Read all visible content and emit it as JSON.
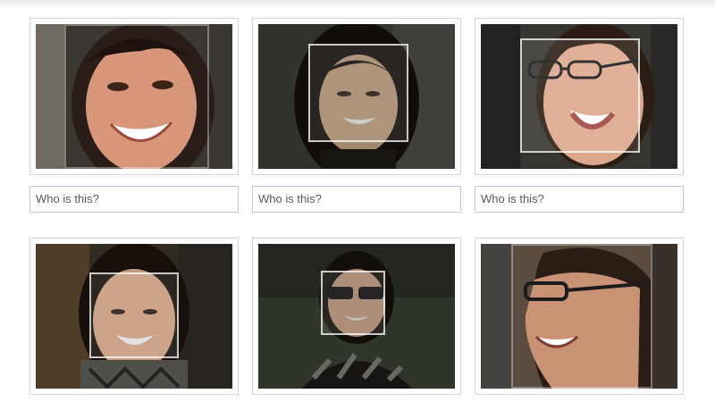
{
  "tag_prompts": [
    "Who is this?",
    "Who is this?",
    "Who is this?"
  ],
  "photos": [
    {
      "name": "photo-woman-smiling-closeup"
    },
    {
      "name": "photo-woman-dark-hair"
    },
    {
      "name": "photo-man-glasses-laughing"
    },
    {
      "name": "photo-woman-smiling-outdoors"
    },
    {
      "name": "photo-woman-sunglasses"
    },
    {
      "name": "photo-man-glasses-profile"
    }
  ]
}
